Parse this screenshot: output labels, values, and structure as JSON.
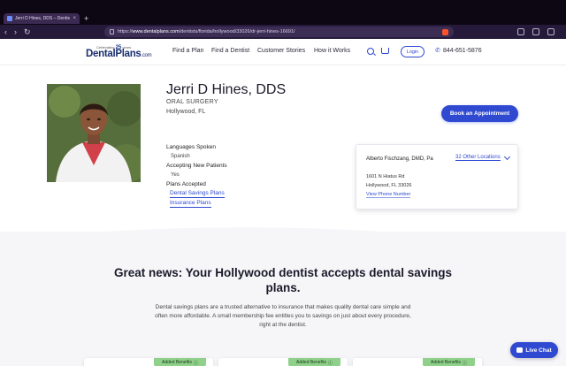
{
  "browser": {
    "tab_title": "Jerri D Hines, DDS – Dentist i…",
    "url_prefix": "https://",
    "url_domain": "www.dentalplans.com",
    "url_path": "/dentists/florida/hollywood/33026/dr-jerri-hines-16691/"
  },
  "header": {
    "logo_tag_prefix": "Celebrating",
    "logo_years": "25",
    "logo_tag_suffix": "years",
    "logo_name": "DentalPlans",
    "logo_suffix": ".com",
    "nav": [
      "Find a Plan",
      "Find a Dentist",
      "Customer Stories",
      "How it Works"
    ],
    "login_label": "Login",
    "phone": "844-651-5876"
  },
  "profile": {
    "name": "Jerri D Hines, DDS",
    "specialty": "ORAL SURGERY",
    "location": "Hollywood, FL",
    "book_label": "Book an Appointment",
    "languages_label": "Languages Spoken",
    "languages_value": "Spanish",
    "accepting_label": "Accepting New Patients",
    "accepting_value": "Yes",
    "plans_label": "Plans Accepted",
    "plan_links": [
      "Dental Savings Plans",
      "Insurance Plans"
    ]
  },
  "location_card": {
    "name": "Alberto Fischzang, DMD, Pa",
    "other_locations": "32 Other Locations",
    "address_line1": "1601 N Hiatus Rd",
    "address_line2": "Hollywood, FL 33026",
    "phone_link": "View Phone Number"
  },
  "promo": {
    "title": "Great news: Your Hollywood dentist accepts dental savings plans.",
    "body": "Dental savings plans are a trusted alternative to insurance that makes quality dental care simple and often more affordable. A small membership fee entitles you to savings on just about every procedure, right at the dentist."
  },
  "plan_cards": [
    {
      "tag": "Added Benefits"
    },
    {
      "tag": "Added Benefits"
    },
    {
      "tag": "Added Benefits"
    }
  ],
  "live_chat_label": "Live Chat",
  "colors": {
    "accent": "#2f49d1",
    "tag_green": "#8fd08a",
    "browser_dark": "#0c0712"
  }
}
